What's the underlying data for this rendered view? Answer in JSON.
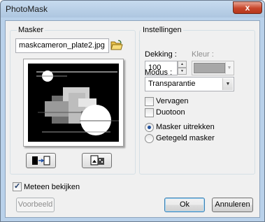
{
  "window": {
    "title": "PhotoMask",
    "close_glyph": "x"
  },
  "mask_group": {
    "label": "Masker",
    "filename": "maskcameron_plate2.jpg",
    "browse_icon": "folder-open-icon",
    "invert_icon": "invert-mask-icon",
    "picture_icon": "image-mask-icon"
  },
  "settings_group": {
    "label": "Instellingen",
    "opacity_label": "Dekking :",
    "opacity_value": "100",
    "color_label": "Kleur :",
    "color_value": "#a8a8a8",
    "mode_label": "Modus :",
    "mode_value": "Transparantie",
    "fade_label": "Vervagen",
    "fade_checked": false,
    "duotone_label": "Duotoon",
    "duotone_checked": false,
    "stretch_label": "Masker uitrekken",
    "stretch_selected": true,
    "tile_label": "Getegeld masker",
    "tile_selected": false
  },
  "preview_toggle": {
    "label": "Meteen bekijken",
    "checked": true
  },
  "buttons": {
    "preview": "Voorbeeld",
    "ok": "Ok",
    "cancel": "Annuleren"
  }
}
